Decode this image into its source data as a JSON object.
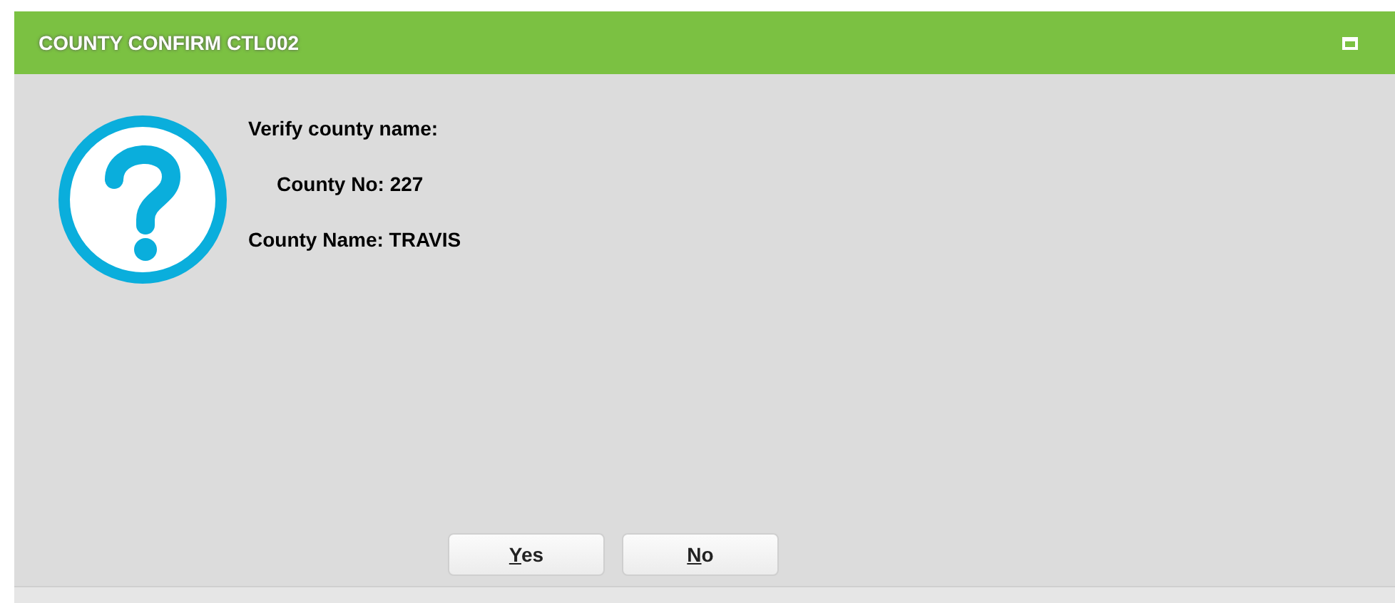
{
  "window": {
    "title": "COUNTY CONFIRM CTL002"
  },
  "message": {
    "heading": "Verify county name:",
    "lines": [
      {
        "text": "County No: 227",
        "indented": true
      },
      {
        "text": "County Name: TRAVIS",
        "indented": false
      }
    ]
  },
  "buttons": [
    {
      "label": "Yes",
      "first_letter_underlined": true
    },
    {
      "label": "No",
      "first_letter_underlined": true
    }
  ]
}
